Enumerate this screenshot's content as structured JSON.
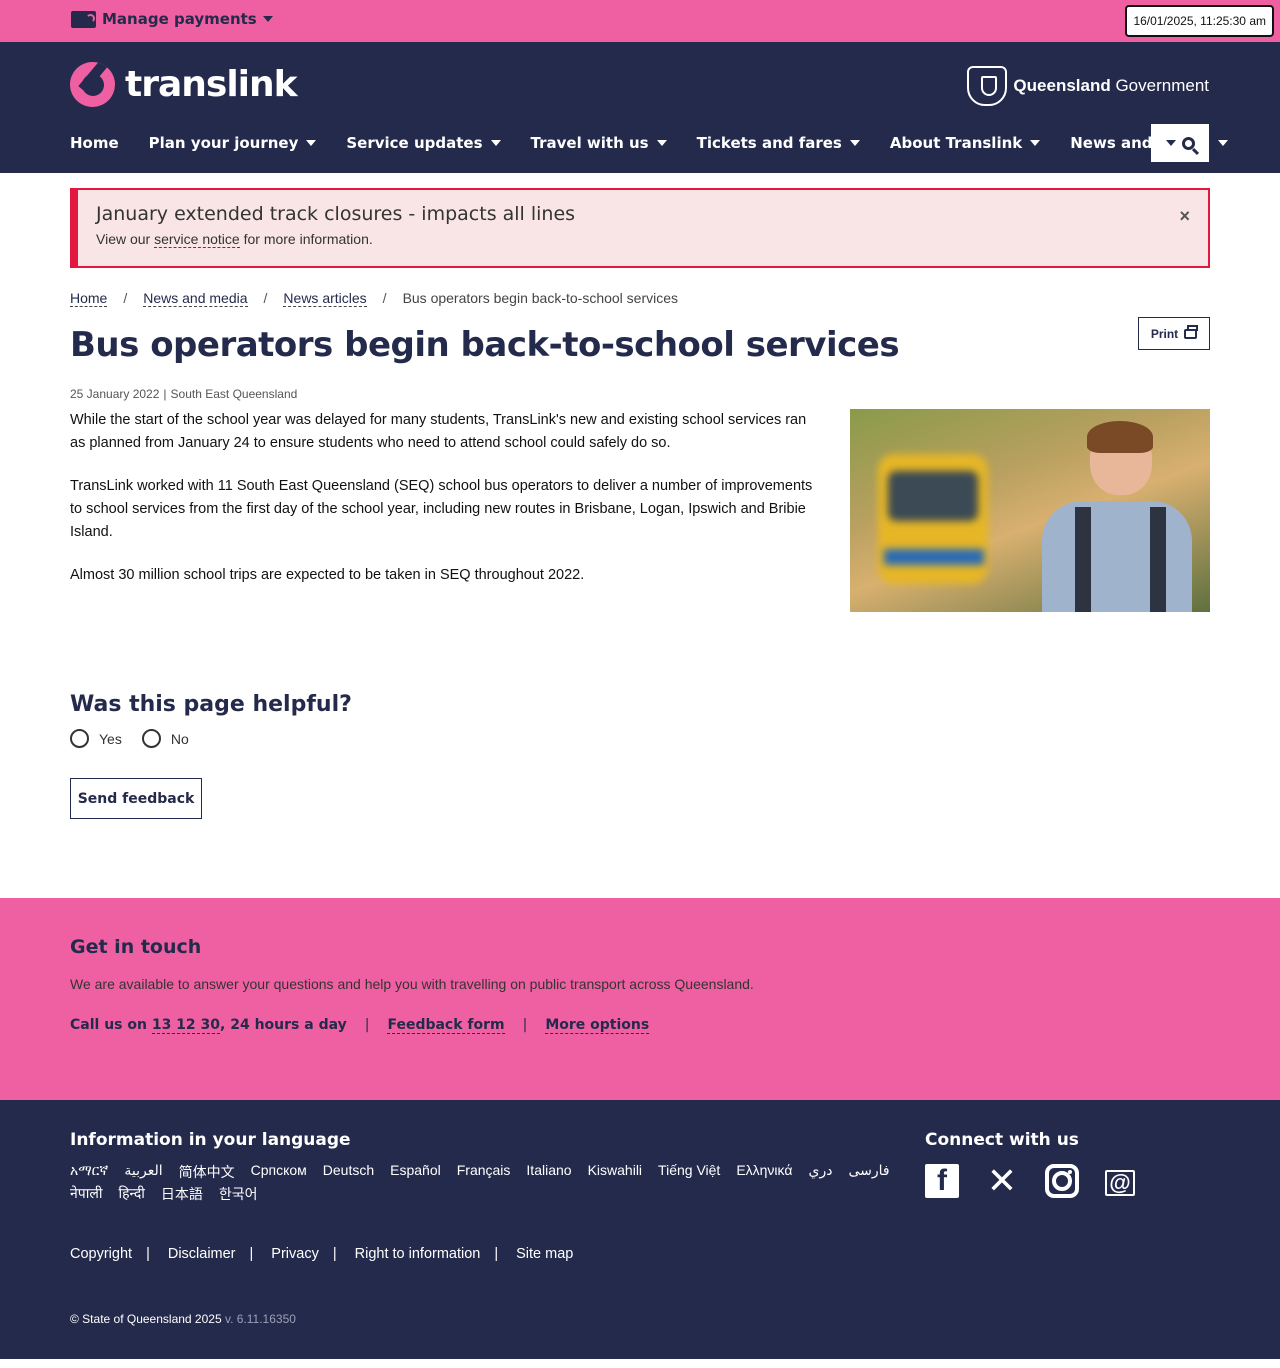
{
  "utility": {
    "manage_payments": "Manage payments",
    "clock": "16/01/2025, 11:25:30 am"
  },
  "header": {
    "logo_text": "translink",
    "gov_bold": "Queensland",
    "gov_rest": " Government",
    "nav": [
      "Home",
      "Plan your journey",
      "Service updates",
      "Travel with us",
      "Tickets and fares",
      "About Translink",
      "News and media"
    ]
  },
  "alert": {
    "title": "January extended track closures - impacts all lines",
    "body_prefix": "View our ",
    "body_link": "service notice",
    "body_suffix": " for more information.",
    "close": "×"
  },
  "breadcrumb": {
    "items": [
      "Home",
      "News and media",
      "News articles"
    ],
    "current": "Bus operators begin back-to-school services",
    "separator": "/"
  },
  "article": {
    "title": "Bus operators begin back-to-school services",
    "print_label": "Print",
    "date": "25 January 2022",
    "region": "South East Queensland",
    "paragraphs": [
      "While the start of the school year was delayed for many students, TransLink's new and existing school services ran as planned from January 24 to ensure students who need to attend school could safely do so.",
      "TransLink worked with 11 South East Queensland (SEQ) school bus operators to deliver a number of improvements to school services from the first day of the school year, including new routes in Brisbane, Logan, Ipswich and Bribie Island.",
      "Almost 30 million school trips are expected to be taken in SEQ throughout 2022."
    ]
  },
  "feedback": {
    "question": "Was this page helpful?",
    "yes": "Yes",
    "no": "No",
    "send": "Send feedback"
  },
  "touch": {
    "title": "Get in touch",
    "desc": "We are available to answer your questions and help you with travelling on public transport across Queensland.",
    "call_prefix": "Call us on ",
    "phone": "13 12 30",
    "call_suffix": ", 24 hours a day",
    "feedback_form": "Feedback form",
    "more_options": "More options",
    "separator": "|"
  },
  "footer": {
    "lang_title": "Information in your language",
    "languages": [
      "አማርኛ",
      "العربية",
      "简体中文",
      "Српском",
      "Deutsch",
      "Español",
      "Français",
      "Italiano",
      "Kiswahili",
      "Tiếng Việt",
      "Ελληνικά",
      "دري",
      "فارسی",
      "नेपाली",
      "हिन्दी",
      "日本語",
      "한국어"
    ],
    "connect_title": "Connect with us",
    "social": [
      "facebook-icon",
      "x-icon",
      "instagram-icon",
      "email-icon"
    ],
    "links": [
      "Copyright",
      "Disclaimer",
      "Privacy",
      "Right to information",
      "Site map"
    ],
    "copyright": "© State of Queensland 2025",
    "version": "v. 6.11.16350"
  },
  "colors": {
    "pink": "#ef60a3",
    "navy": "#242a4b",
    "alert_red": "#e4173e",
    "alert_bg": "#f9e5e6"
  }
}
